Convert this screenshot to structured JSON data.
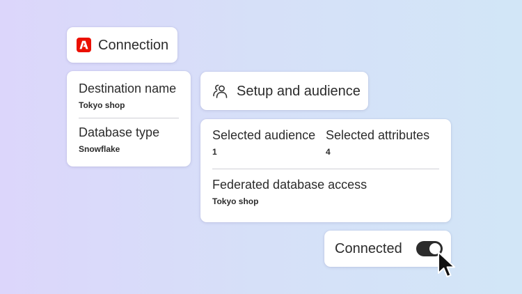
{
  "colors": {
    "adobe_red": "#eb1000",
    "toggle_on": "#2c2c2c",
    "card_bg": "#ffffff"
  },
  "connection": {
    "icon": "adobe-logo-icon",
    "title": "Connection"
  },
  "details": {
    "destination_name_label": "Destination name",
    "destination_name_value": "Tokyo shop",
    "database_type_label": "Database type",
    "database_type_value": "Snowflake"
  },
  "setup": {
    "icon": "people-icon",
    "title": "Setup and audience"
  },
  "audience": {
    "selected_audience_label": "Selected audience",
    "selected_audience_value": "1",
    "selected_attributes_label": "Selected attributes",
    "selected_attributes_value": "4",
    "federated_access_label": "Federated database access",
    "federated_access_value": "Tokyo shop"
  },
  "status": {
    "label": "Connected",
    "toggle_on": true,
    "cursor": "pointer-cursor-icon"
  }
}
